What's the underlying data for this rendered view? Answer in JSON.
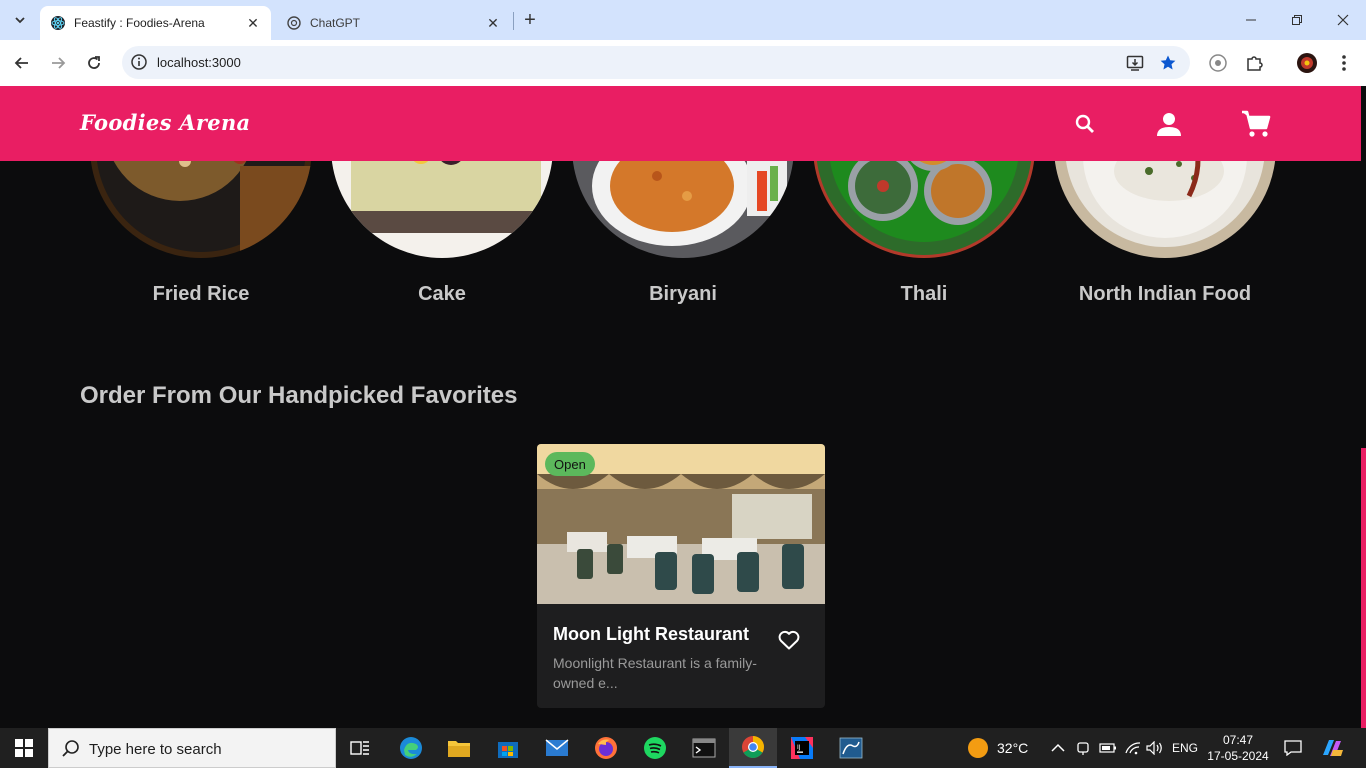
{
  "browser": {
    "tabs": [
      {
        "title": "Feastify : Foodies-Arena",
        "active": true
      },
      {
        "title": "ChatGPT",
        "active": false
      }
    ],
    "url": "localhost:3000"
  },
  "app": {
    "logo": "Foodies Arena"
  },
  "categories": [
    {
      "label": "Fried Rice"
    },
    {
      "label": "Cake"
    },
    {
      "label": "Biryani"
    },
    {
      "label": "Thali"
    },
    {
      "label": "North Indian Food"
    }
  ],
  "section_title": "Order From Our Handpicked Favorites",
  "restaurant": {
    "status": "Open",
    "name": "Moon Light Restaurant",
    "description": "Moonlight Restaurant is a family-owned e..."
  },
  "taskbar": {
    "search_placeholder": "Type here to search",
    "weather": "32°C",
    "language": "ENG",
    "time": "07:47",
    "date": "17-05-2024"
  },
  "colors": {
    "brand": "#e91e63",
    "page_bg": "#0c0c0d",
    "card_bg": "#1e1e1f",
    "open_badge": "#5cb85c"
  }
}
